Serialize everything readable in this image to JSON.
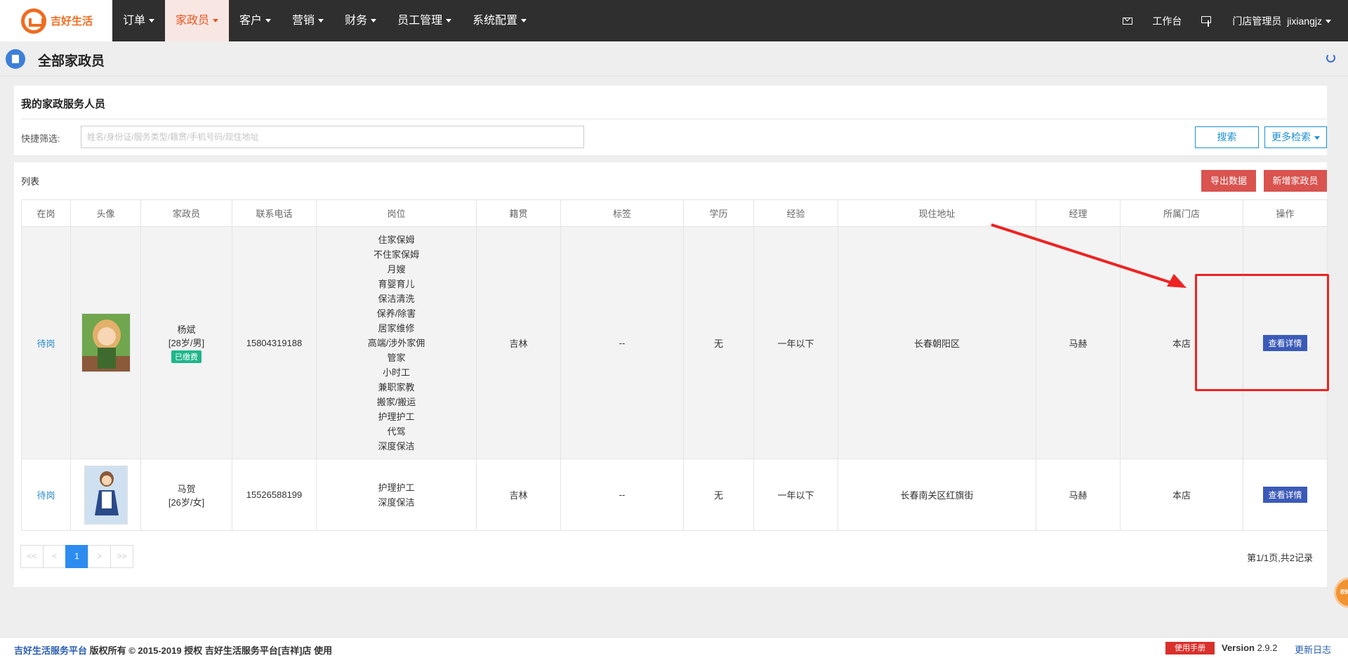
{
  "app": {
    "logo_text": "吉好生活"
  },
  "nav": {
    "items": [
      {
        "label": "订单"
      },
      {
        "label": "家政员"
      },
      {
        "label": "客户"
      },
      {
        "label": "营销"
      },
      {
        "label": "财务"
      },
      {
        "label": "员工管理"
      },
      {
        "label": "系统配置"
      }
    ],
    "active_index": 1,
    "workbench": "工作台",
    "user_role": "门店管理员",
    "username": "jixiangjz"
  },
  "page": {
    "title": "全部家政员"
  },
  "filter_panel": {
    "title": "我的家政服务人员",
    "filter_label": "快捷筛选:",
    "search_placeholder": "姓名/身份证/服务类型/籍贯/手机号码/现住地址",
    "search_button": "搜索",
    "more_button": "更多检索"
  },
  "list_panel": {
    "title": "列表",
    "export_button": "导出数据",
    "add_button": "新增家政员"
  },
  "table": {
    "headers": [
      "在岗",
      "头像",
      "家政员",
      "联系电话",
      "岗位",
      "籍贯",
      "标签",
      "学历",
      "经验",
      "现住地址",
      "经理",
      "所属门店",
      "操作"
    ],
    "rows": [
      {
        "status": "待岗",
        "name": "杨斌",
        "age_gender": "[28岁/男]",
        "badge": "已缴费",
        "phone": "15804319188",
        "positions": [
          "住家保姆",
          "不住家保姆",
          "月嫂",
          "育婴育儿",
          "保洁清洗",
          "保养/除害",
          "居家维修",
          "高端/涉外家佣",
          "管家",
          "小时工",
          "兼职家教",
          "搬家/搬运",
          "护理护工",
          "代驾",
          "深度保洁"
        ],
        "hometown": "吉林",
        "tags": "--",
        "education": "无",
        "experience": "一年以下",
        "address": "长春朝阳区",
        "manager": "马赫",
        "store": "本店",
        "action": "查看详情"
      },
      {
        "status": "待岗",
        "name": "马贺",
        "age_gender": "[26岁/女]",
        "phone": "15526588199",
        "positions": [
          "护理护工",
          "深度保洁"
        ],
        "hometown": "吉林",
        "tags": "--",
        "education": "无",
        "experience": "一年以下",
        "address": "长春南关区红旗街",
        "manager": "马赫",
        "store": "本店",
        "action": "查看详情"
      }
    ]
  },
  "pagination": {
    "first": "<<",
    "prev": "<",
    "current": "1",
    "next": ">",
    "last": ">>",
    "info": "第1/1页,共2记录"
  },
  "side_badge": "89",
  "footer": {
    "brand": "吉好生活服务平台",
    "copyright": " 版权所有 © 2015-2019 授权 ",
    "licensee": "吉好生活服务平台[吉祥]店",
    "use": " 使用",
    "manual": "使用手册",
    "version_label": "Version",
    "version": "2.9.2",
    "changelog": "更新日志"
  },
  "colors": {
    "nav_bg": "#2f2f2f",
    "accent": "#e8561e",
    "danger": "#d9534f",
    "primary": "#2d8cf0",
    "annotation": "#ee2222"
  }
}
